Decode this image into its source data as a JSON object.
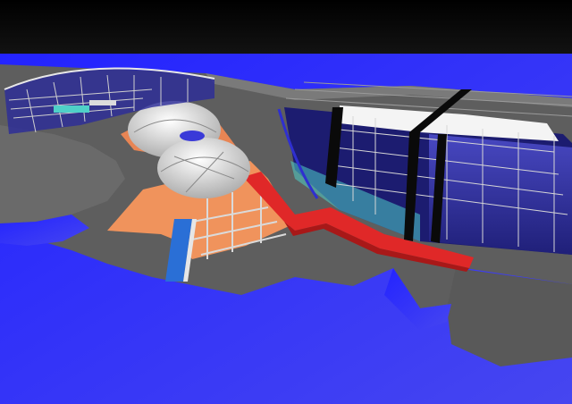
{
  "scene": {
    "colors": {
      "sky_top": "#000000",
      "sky_bottom": "#8a8a8a",
      "water": "#2b2bff",
      "water_deep": "#1a1ad8",
      "ground": "#5e5e5e",
      "ground_light": "#7a7a7a",
      "deck": "#f0935c",
      "walkway": "#e02828",
      "dome": "#e8e8e8",
      "glass": "#3a3ab8",
      "frame": "#0a0a0a",
      "roof": "#f4f4f4",
      "pier": "#2a6fd6",
      "accent_cyan": "#4fd0c8"
    }
  }
}
